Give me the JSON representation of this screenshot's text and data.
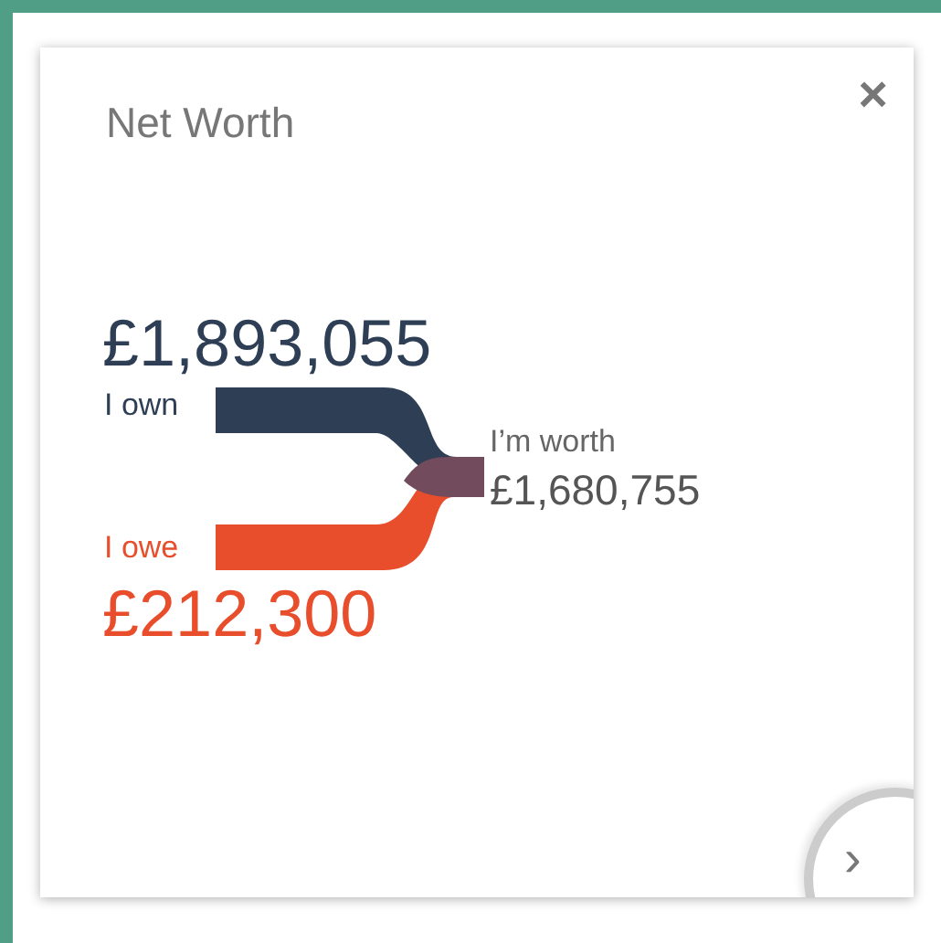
{
  "card": {
    "title": "Net Worth",
    "close": "×",
    "next": "›"
  },
  "own": {
    "label": "I own",
    "amount": "£1,893,055"
  },
  "owe": {
    "label": "I owe",
    "amount": "£212,300"
  },
  "worth": {
    "label": "I’m worth",
    "amount": "£1,680,755"
  }
}
